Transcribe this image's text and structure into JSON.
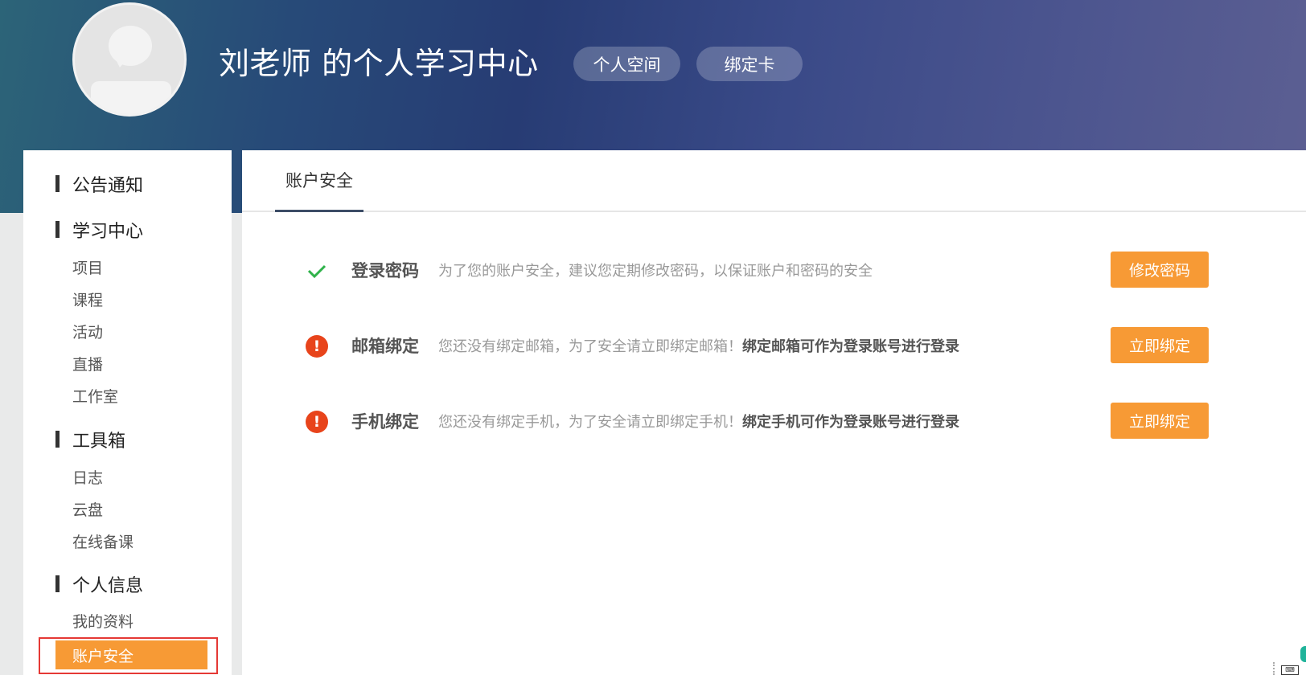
{
  "header": {
    "title": "刘老师 的个人学习中心",
    "buttons": [
      "个人空间",
      "绑定卡"
    ]
  },
  "sidebar": {
    "sections": [
      {
        "title": "公告通知",
        "items": []
      },
      {
        "title": "学习中心",
        "items": [
          "项目",
          "课程",
          "活动",
          "直播",
          "工作室"
        ]
      },
      {
        "title": "工具箱",
        "items": [
          "日志",
          "云盘",
          "在线备课"
        ]
      },
      {
        "title": "个人信息",
        "items": [
          "我的资料",
          "账户安全"
        ]
      }
    ],
    "active_item": "账户安全"
  },
  "main": {
    "tab": "账户安全",
    "rows": [
      {
        "name": "登录密码",
        "status": "ok",
        "icon": "check-icon",
        "desc": "为了您的账户安全，建议您定期修改密码，以保证账户和密码的安全",
        "desc_bold": "",
        "button": "修改密码"
      },
      {
        "name": "邮箱绑定",
        "status": "warning",
        "icon": "warning-icon",
        "desc": "您还没有绑定邮箱，为了安全请立即绑定邮箱！",
        "desc_bold": "绑定邮箱可作为登录账号进行登录",
        "button": "立即绑定"
      },
      {
        "name": "手机绑定",
        "status": "warning",
        "icon": "warning-icon",
        "desc": "您还没有绑定手机，为了安全请立即绑定手机！",
        "desc_bold": "绑定手机可作为登录账号进行登录",
        "button": "立即绑定"
      }
    ]
  },
  "colors": {
    "accent": "#f79a35",
    "warning": "#e8441b",
    "ok": "#2fb24a",
    "highlight_border": "#e53935"
  }
}
